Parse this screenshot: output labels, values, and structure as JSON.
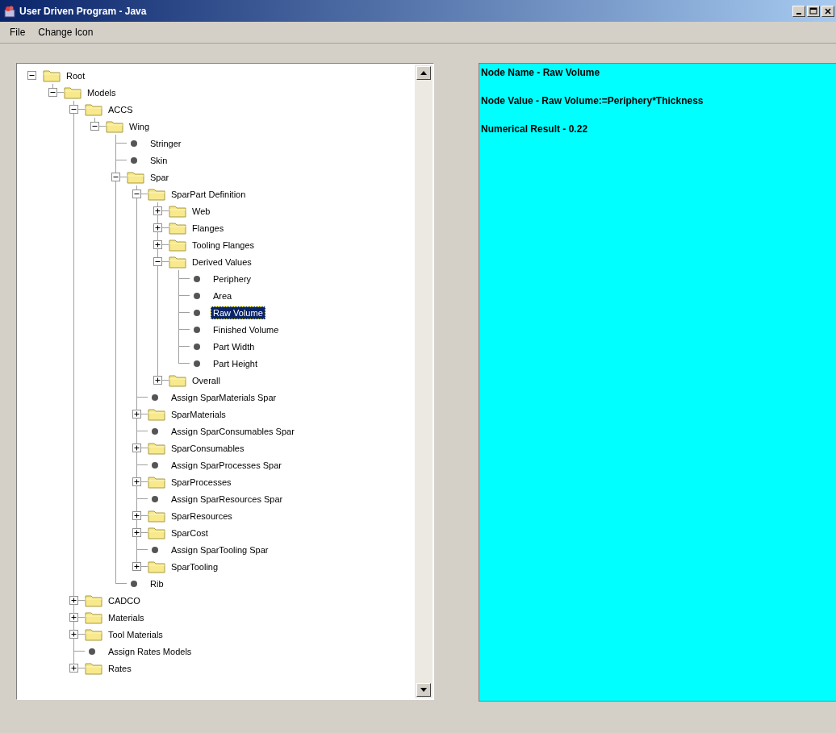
{
  "window": {
    "title": "User Driven Program - Java"
  },
  "menu": [
    {
      "label": "File"
    },
    {
      "label": "Change Icon"
    }
  ],
  "tree": [
    {
      "label": "Root",
      "kind": "folder",
      "expanded": true,
      "selected": false,
      "children": [
        {
          "label": "Models",
          "kind": "folder",
          "expanded": true,
          "selected": false,
          "children": [
            {
              "label": "ACCS",
              "kind": "folder",
              "expanded": true,
              "selected": false,
              "children": [
                {
                  "label": "Wing",
                  "kind": "folder",
                  "expanded": true,
                  "selected": false,
                  "children": [
                    {
                      "label": "Stringer",
                      "kind": "leaf",
                      "selected": false
                    },
                    {
                      "label": "Skin",
                      "kind": "leaf",
                      "selected": false
                    },
                    {
                      "label": "Spar",
                      "kind": "folder",
                      "expanded": true,
                      "selected": false,
                      "children": [
                        {
                          "label": "SparPart Definition",
                          "kind": "folder",
                          "expanded": true,
                          "selected": false,
                          "children": [
                            {
                              "label": "Web",
                              "kind": "folder",
                              "expanded": false,
                              "selected": false
                            },
                            {
                              "label": "Flanges",
                              "kind": "folder",
                              "expanded": false,
                              "selected": false
                            },
                            {
                              "label": "Tooling Flanges",
                              "kind": "folder",
                              "expanded": false,
                              "selected": false
                            },
                            {
                              "label": "Derived Values",
                              "kind": "folder",
                              "expanded": true,
                              "selected": false,
                              "children": [
                                {
                                  "label": "Periphery",
                                  "kind": "leaf",
                                  "selected": false
                                },
                                {
                                  "label": "Area",
                                  "kind": "leaf",
                                  "selected": false
                                },
                                {
                                  "label": "Raw Volume",
                                  "kind": "leaf",
                                  "selected": true
                                },
                                {
                                  "label": "Finished Volume",
                                  "kind": "leaf",
                                  "selected": false
                                },
                                {
                                  "label": "Part Width",
                                  "kind": "leaf",
                                  "selected": false
                                },
                                {
                                  "label": "Part Height",
                                  "kind": "leaf",
                                  "selected": false
                                }
                              ]
                            },
                            {
                              "label": "Overall",
                              "kind": "folder",
                              "expanded": false,
                              "selected": false
                            }
                          ]
                        },
                        {
                          "label": "Assign SparMaterials Spar",
                          "kind": "leaf",
                          "selected": false
                        },
                        {
                          "label": "SparMaterials",
                          "kind": "folder",
                          "expanded": false,
                          "selected": false
                        },
                        {
                          "label": "Assign SparConsumables Spar",
                          "kind": "leaf",
                          "selected": false
                        },
                        {
                          "label": "SparConsumables",
                          "kind": "folder",
                          "expanded": false,
                          "selected": false
                        },
                        {
                          "label": "Assign SparProcesses Spar",
                          "kind": "leaf",
                          "selected": false
                        },
                        {
                          "label": "SparProcesses",
                          "kind": "folder",
                          "expanded": false,
                          "selected": false
                        },
                        {
                          "label": "Assign SparResources Spar",
                          "kind": "leaf",
                          "selected": false
                        },
                        {
                          "label": "SparResources",
                          "kind": "folder",
                          "expanded": false,
                          "selected": false
                        },
                        {
                          "label": "SparCost",
                          "kind": "folder",
                          "expanded": false,
                          "selected": false
                        },
                        {
                          "label": "Assign SparTooling Spar",
                          "kind": "leaf",
                          "selected": false
                        },
                        {
                          "label": "SparTooling",
                          "kind": "folder",
                          "expanded": false,
                          "selected": false
                        }
                      ]
                    },
                    {
                      "label": "Rib",
                      "kind": "leaf",
                      "selected": false
                    }
                  ]
                }
              ]
            },
            {
              "label": "CADCO",
              "kind": "folder",
              "expanded": false,
              "selected": false
            },
            {
              "label": "Materials",
              "kind": "folder",
              "expanded": false,
              "selected": false
            },
            {
              "label": "Tool Materials",
              "kind": "folder",
              "expanded": false,
              "selected": false
            },
            {
              "label": "Assign Rates Models",
              "kind": "leaf",
              "selected": false
            },
            {
              "label": "Rates",
              "kind": "folder",
              "expanded": false,
              "selected": false
            }
          ]
        }
      ]
    }
  ],
  "details": {
    "lines": [
      "Node Name - Raw Volume",
      "Node Value - Raw Volume:=Periphery*Thickness",
      "Numerical Result - 0.22"
    ]
  }
}
